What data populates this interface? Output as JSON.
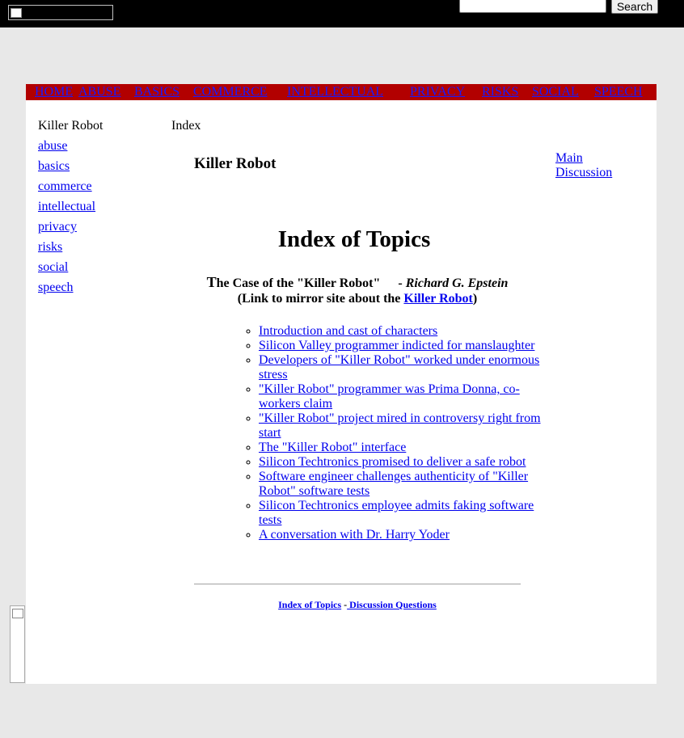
{
  "search": {
    "button_label": "Search",
    "value": "",
    "placeholder": ""
  },
  "colors": {
    "topbar": "#000000",
    "navbar": "#b20000",
    "page_background": "#e8e8e8",
    "link": "#0000ee"
  },
  "top_nav": {
    "items": [
      {
        "label": "HOME"
      },
      {
        "label": "ABUSE"
      },
      {
        "label": "BASICS"
      },
      {
        "label": "COMMERCE"
      },
      {
        "label": "INTELLECTUAL"
      },
      {
        "label": "PRIVACY"
      },
      {
        "label": "RISKS"
      },
      {
        "label": "SOCIAL"
      },
      {
        "label": "SPEECH"
      }
    ]
  },
  "sidebar": {
    "title": "Killer Robot",
    "items": [
      "abuse",
      "basics",
      "commerce",
      "intellectual",
      "privacy",
      "risks",
      "social",
      "speech"
    ]
  },
  "breadcrumb": "Index",
  "page_heading": "Killer Robot",
  "right_links": {
    "line1": "Main",
    "line2": "Discussion"
  },
  "main": {
    "title": "Index of Topics",
    "subtitle": {
      "case_prefix": "T",
      "case_title": "he Case of the \"Killer Robot\"",
      "dash": "-",
      "author": "Richard G. Epstein",
      "mirror_prefix": "(Link to mirror site about the ",
      "mirror_link": "Killer Robot",
      "mirror_suffix": ")"
    },
    "topics": [
      "Introduction and cast of characters",
      "Silicon Valley programmer indicted for manslaughter",
      "Developers of \"Killer Robot\" worked under enormous stress",
      "\"Killer Robot\" programmer was Prima Donna, co-workers claim",
      "\"Killer Robot\" project mired in controversy right from start",
      "The \"Killer Robot\" interface",
      "Silicon Techtronics promised to deliver a safe robot",
      "Software engineer challenges authenticity of \"Killer Robot\" software tests",
      "Silicon Techtronics employee admits faking software tests",
      "A conversation with Dr. Harry Yoder"
    ]
  },
  "footer": {
    "index_link": "Index of Topics",
    "separator": "-",
    "discussion_link": " Discussion Questions"
  }
}
